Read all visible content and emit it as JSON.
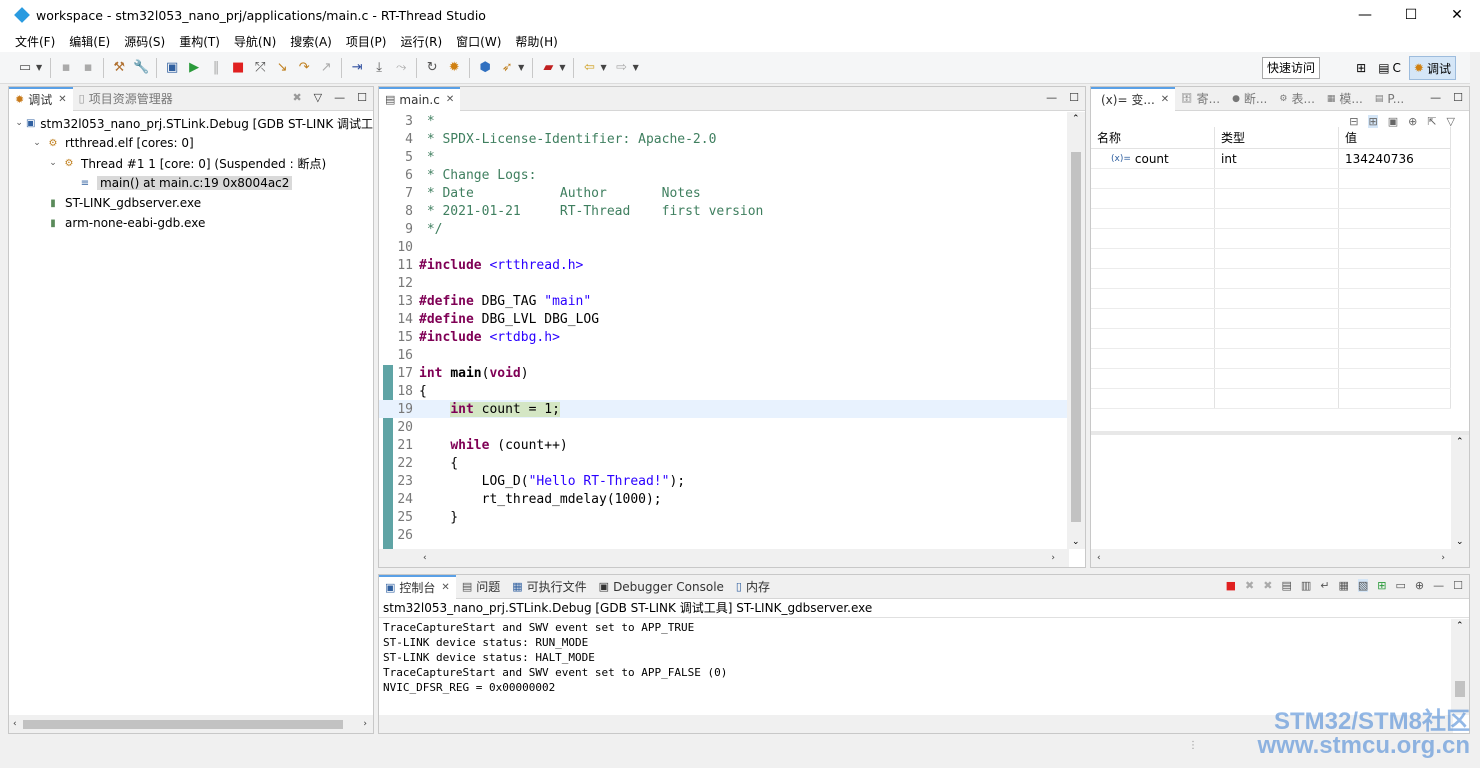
{
  "window": {
    "title": "workspace - stm32l053_nano_prj/applications/main.c - RT-Thread Studio",
    "minimize": "—",
    "maximize": "☐",
    "close": "✕"
  },
  "menu": [
    "文件(F)",
    "编辑(E)",
    "源码(S)",
    "重构(T)",
    "导航(N)",
    "搜索(A)",
    "项目(P)",
    "运行(R)",
    "窗口(W)",
    "帮助(H)"
  ],
  "toolbar": {
    "quick_access": "快速访问",
    "perspective_c": "C",
    "perspective_debug": "调试"
  },
  "debug_view": {
    "tabs": [
      {
        "label": "调试",
        "active": true
      },
      {
        "label": "项目资源管理器",
        "active": false
      }
    ],
    "tree": [
      {
        "label": "stm32l053_nano_prj.STLink.Debug [GDB ST-LINK 调试工",
        "indent": 0,
        "twisty": "⌄",
        "icon": "launch-config-icon",
        "selected": false
      },
      {
        "label": "rtthread.elf [cores: 0]",
        "indent": 1,
        "twisty": "⌄",
        "icon": "process-icon",
        "selected": false
      },
      {
        "label": "Thread #1 1 [core: 0] (Suspended : 断点)",
        "indent": 2,
        "twisty": "⌄",
        "icon": "thread-icon",
        "selected": false
      },
      {
        "label": "main() at main.c:19 0x8004ac2",
        "indent": 3,
        "twisty": "",
        "icon": "stack-frame-icon",
        "selected": true
      },
      {
        "label": "ST-LINK_gdbserver.exe",
        "indent": 1,
        "twisty": "",
        "icon": "executable-icon",
        "selected": false
      },
      {
        "label": "arm-none-eabi-gdb.exe",
        "indent": 1,
        "twisty": "",
        "icon": "executable-icon",
        "selected": false
      }
    ]
  },
  "editor": {
    "tab": "main.c",
    "lines": [
      {
        "n": "3",
        "segs": [
          {
            "t": " *",
            "c": "com"
          }
        ]
      },
      {
        "n": "4",
        "segs": [
          {
            "t": " * SPDX-License-Identifier: Apache-2.0",
            "c": "com"
          }
        ]
      },
      {
        "n": "5",
        "segs": [
          {
            "t": " *",
            "c": "com"
          }
        ]
      },
      {
        "n": "6",
        "segs": [
          {
            "t": " * Change Logs:",
            "c": "com"
          }
        ]
      },
      {
        "n": "7",
        "segs": [
          {
            "t": " * Date           Author       Notes",
            "c": "com"
          }
        ]
      },
      {
        "n": "8",
        "segs": [
          {
            "t": " * 2021-01-21     RT-Thread    first version",
            "c": "com"
          }
        ]
      },
      {
        "n": "9",
        "segs": [
          {
            "t": " */",
            "c": "com"
          }
        ]
      },
      {
        "n": "10",
        "segs": []
      },
      {
        "n": "11",
        "segs": [
          {
            "t": "#include ",
            "c": "kw"
          },
          {
            "t": "<rtthread.h>",
            "c": "str"
          }
        ]
      },
      {
        "n": "12",
        "segs": []
      },
      {
        "n": "13",
        "segs": [
          {
            "t": "#define ",
            "c": "kw"
          },
          {
            "t": "DBG_TAG ",
            "c": ""
          },
          {
            "t": "\"main\"",
            "c": "str"
          }
        ]
      },
      {
        "n": "14",
        "segs": [
          {
            "t": "#define ",
            "c": "kw"
          },
          {
            "t": "DBG_LVL DBG_LOG",
            "c": ""
          }
        ]
      },
      {
        "n": "15",
        "segs": [
          {
            "t": "#include ",
            "c": "kw"
          },
          {
            "t": "<rtdbg.h>",
            "c": "str"
          }
        ]
      },
      {
        "n": "16",
        "segs": []
      },
      {
        "n": "17",
        "segs": [
          {
            "t": "int ",
            "c": "kw"
          },
          {
            "t": "main",
            "c": "b"
          },
          {
            "t": "(",
            "c": ""
          },
          {
            "t": "void",
            "c": "kw"
          },
          {
            "t": ")",
            "c": ""
          }
        ]
      },
      {
        "n": "18",
        "segs": [
          {
            "t": "{",
            "c": ""
          }
        ]
      },
      {
        "n": "19",
        "segs": [
          {
            "t": "    ",
            "c": ""
          },
          {
            "t": "int",
            "c": "kw hl"
          },
          {
            "t": " count = 1;",
            "c": "hl"
          }
        ],
        "current": true
      },
      {
        "n": "20",
        "segs": []
      },
      {
        "n": "21",
        "segs": [
          {
            "t": "    ",
            "c": ""
          },
          {
            "t": "while",
            "c": "kw"
          },
          {
            "t": " (count++)",
            "c": ""
          }
        ]
      },
      {
        "n": "22",
        "segs": [
          {
            "t": "    {",
            "c": ""
          }
        ]
      },
      {
        "n": "23",
        "segs": [
          {
            "t": "        LOG_D(",
            "c": ""
          },
          {
            "t": "\"Hello RT-Thread!\"",
            "c": "str"
          },
          {
            "t": ");",
            "c": ""
          }
        ]
      },
      {
        "n": "24",
        "segs": [
          {
            "t": "        rt_thread_mdelay(1000);",
            "c": ""
          }
        ]
      },
      {
        "n": "25",
        "segs": [
          {
            "t": "    }",
            "c": ""
          }
        ]
      },
      {
        "n": "26",
        "segs": []
      }
    ]
  },
  "variables_view": {
    "tabs": [
      "(x)= 变...",
      "寄...",
      "断...",
      "表...",
      "模...",
      "P..."
    ],
    "columns": [
      "名称",
      "类型",
      "值"
    ],
    "rows": [
      {
        "name": "count",
        "type": "int",
        "value": "134240736"
      }
    ]
  },
  "console_view": {
    "tabs": [
      "控制台",
      "问题",
      "可执行文件",
      "Debugger Console",
      "内存"
    ],
    "header": "stm32l053_nano_prj.STLink.Debug [GDB ST-LINK 调试工具] ST-LINK_gdbserver.exe",
    "lines": [
      "TraceCaptureStart and SWV event set to APP_TRUE",
      "ST-LINK device status: RUN_MODE",
      "ST-LINK device status: HALT_MODE",
      "TraceCaptureStart and SWV event set to APP_FALSE (0)",
      "NVIC_DFSR_REG = 0x00000002"
    ]
  },
  "watermark": {
    "line1": "STM32/STM8社区",
    "line2": "www.stmcu.org.cn"
  }
}
